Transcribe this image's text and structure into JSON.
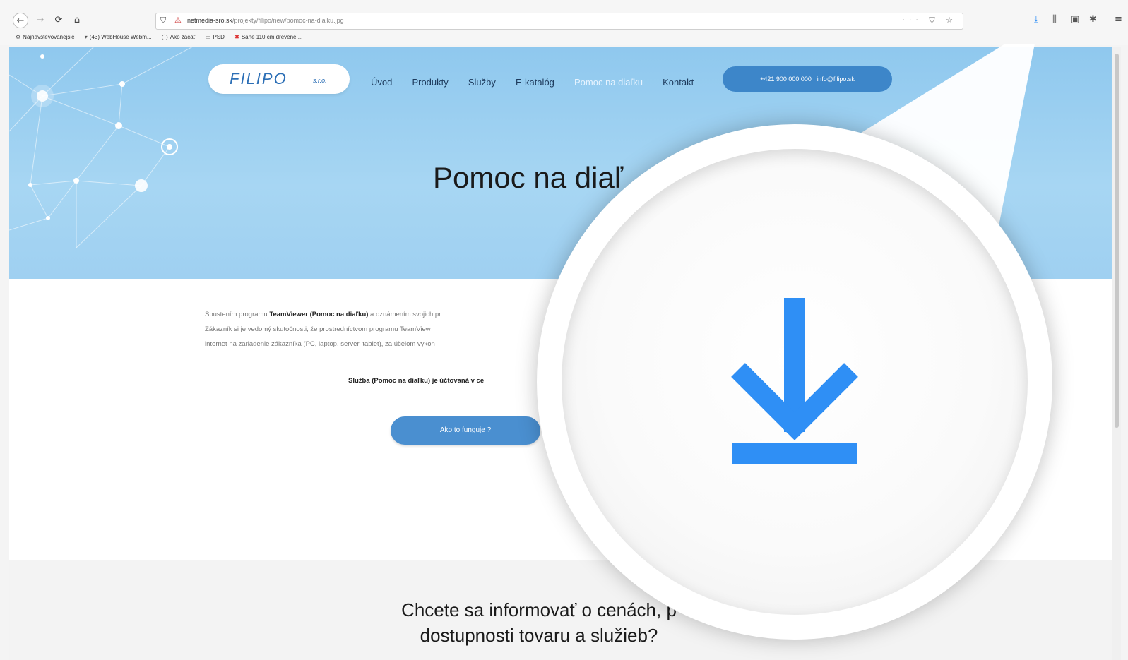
{
  "browser": {
    "url_host": "netmedia-sro.sk",
    "url_path": "/projekty/filipo/new/pomoc-na-dialku.jpg",
    "url_right_icons": "··· ⛉ ☆",
    "nav": {
      "back": "←",
      "forward": "→",
      "reload": "⟳",
      "home": "⌂"
    },
    "toolbar_icons": {
      "download": "⤓",
      "library": "⫼",
      "sync": "▣",
      "addon": "✱",
      "menu": "≡"
    },
    "bookmarks": [
      {
        "icon": "⚙",
        "label": "Najnavštevovanejšie"
      },
      {
        "icon": "▾",
        "label": "(43) WebHouse Webm..."
      },
      {
        "icon": "◯",
        "label": "Ako začať"
      },
      {
        "icon": "▭",
        "label": "PSD"
      },
      {
        "icon": "✖",
        "label": "Sane 110 cm drevené ..."
      }
    ]
  },
  "site": {
    "logo": {
      "name": "FILIPO",
      "suffix": "s.r.o."
    },
    "nav": [
      {
        "label": "Úvod"
      },
      {
        "label": "Produkty"
      },
      {
        "label": "Služby"
      },
      {
        "label": "E-katalóg"
      },
      {
        "label": "Pomoc na diaľku",
        "active": true
      },
      {
        "label": "Kontakt"
      }
    ],
    "contact": "+421 900 000 000 | info@filipo.sk",
    "hero_title": "Pomoc na diaľ",
    "intro": {
      "line1_pre": "Spustením programu ",
      "line1_bold": "TeamViewer (Pomoc na diaľku)",
      "line1_post": " a oznámením svojich pr",
      "line2": "Zákazník si je vedomý skutočnosti, že prostredníctvom programu TeamView",
      "line3": "internet na zariadenie zákazníka (PC, laptop, server, tablet), za účelom vykon"
    },
    "fee_line": "Služba (Pomoc na diaľku) je účtovaná v ce",
    "how_button": "Ako to funguje ?",
    "cta": "Chcete sa informovať o cenách, p dostupnosti tovaru a služieb?"
  },
  "colors": {
    "accent": "#2f8ff5",
    "hero": "#a7d6f3",
    "button": "#4a8fd0"
  }
}
